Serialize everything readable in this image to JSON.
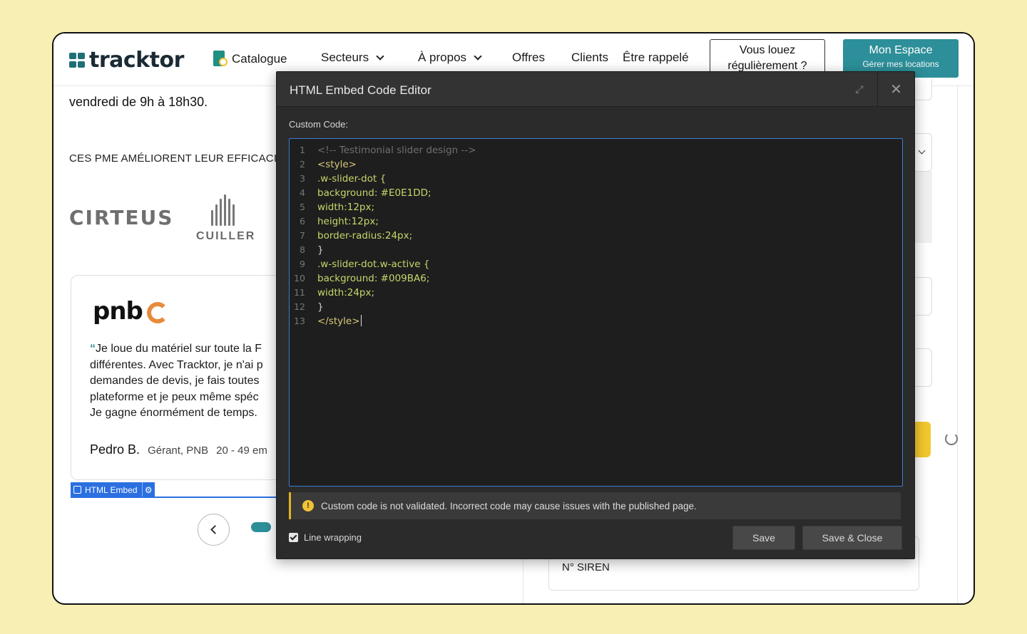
{
  "site": {
    "logo": "tracktor",
    "nav": {
      "catalogue": "Catalogue",
      "secteurs": "Secteurs",
      "apropos": "À propos",
      "offres": "Offres",
      "clients": "Clients",
      "rappel": "Être rappelé"
    },
    "btn_louez_line1": "Vous louez",
    "btn_louez_line2": "régulièrement ?",
    "btn_espace_line1": "Mon Espace",
    "btn_espace_line2": "Gérer mes locations"
  },
  "page": {
    "hours": "vendredi de 9h à 18h30.",
    "pme_title": "CES PME AMÉLIORENT LEUR EFFICACITÉ",
    "logo_cirteus": "CIRTEUS",
    "logo_cuiller": "CUILLER",
    "testimonial": {
      "logo": "pnb",
      "quote_lines": [
        "Je loue du matériel sur toute la F",
        "différentes. Avec Tracktor, je n'ai p",
        "demandes de devis, je fais toutes",
        "plateforme et je peux même spéc",
        "Je gagne énormément de temps."
      ],
      "author": "Pedro B.",
      "role": "Gérant, PNB",
      "size": "20 - 49 em"
    },
    "embed_tag": "HTML Embed",
    "siren_label": "N° SIREN"
  },
  "modal": {
    "title": "HTML Embed Code Editor",
    "code_label": "Custom Code:",
    "code_lines": [
      {
        "n": "1",
        "text": "<!-- Testimonial slider design -->"
      },
      {
        "n": "2",
        "text": "<style>"
      },
      {
        "n": "3",
        "text": ".w-slider-dot {"
      },
      {
        "n": "4",
        "text": "background: #E0E1DD;"
      },
      {
        "n": "5",
        "text": "width:12px;"
      },
      {
        "n": "6",
        "text": "height:12px;"
      },
      {
        "n": "7",
        "text": "border-radius:24px;"
      },
      {
        "n": "8",
        "text": "}"
      },
      {
        "n": "9",
        "text": ".w-slider-dot.w-active {"
      },
      {
        "n": "10",
        "text": "background: #009BA6;"
      },
      {
        "n": "11",
        "text": "width:24px;"
      },
      {
        "n": "12",
        "text": "}"
      },
      {
        "n": "13",
        "text": "</style>"
      }
    ],
    "warning": "Custom code is not validated. Incorrect code may cause issues with the published page.",
    "line_wrapping": "Line wrapping",
    "save": "Save",
    "save_close": "Save & Close"
  },
  "colors": {
    "brand": "#2d8f99",
    "accent_yellow": "#f3c72d",
    "editor_bg": "#1e1e1e",
    "editor_border": "#3b7cd6"
  }
}
